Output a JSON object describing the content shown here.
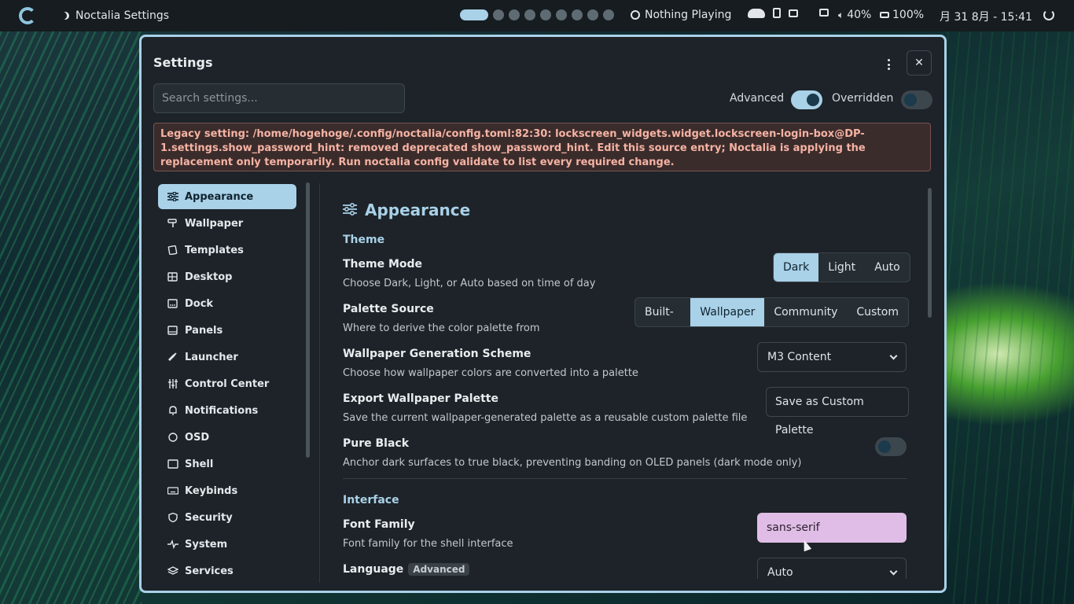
{
  "topbar": {
    "app_title": "Noctalia Settings",
    "workspaces": [
      true,
      false,
      false,
      false,
      false,
      false,
      false,
      false,
      false
    ],
    "media": "Nothing Playing",
    "volume": "40%",
    "battery": "100%",
    "datetime": "月 31 8月 - 15:41"
  },
  "window": {
    "title": "Settings",
    "search_placeholder": "Search settings...",
    "advanced_label": "Advanced",
    "advanced_on": true,
    "overridden_label": "Overridden",
    "overridden_on": false,
    "warning": "Legacy setting: /home/hogehoge/.config/noctalia/config.toml:82:30: lockscreen_widgets.widget.lockscreen-login-box@DP-1.settings.show_password_hint: removed deprecated show_password_hint. Edit this source entry; Noctalia is applying the replacement only temporarily. Run noctalia config validate to list every required change."
  },
  "sidebar": {
    "items": [
      {
        "label": "Appearance",
        "icon": "sliders-icon",
        "active": true
      },
      {
        "label": "Wallpaper",
        "icon": "paint-roller-icon"
      },
      {
        "label": "Templates",
        "icon": "templates-icon"
      },
      {
        "label": "Desktop",
        "icon": "desktop-icon"
      },
      {
        "label": "Dock",
        "icon": "dock-icon"
      },
      {
        "label": "Panels",
        "icon": "panels-icon"
      },
      {
        "label": "Launcher",
        "icon": "rocket-icon"
      },
      {
        "label": "Control Center",
        "icon": "control-center-icon"
      },
      {
        "label": "Notifications",
        "icon": "bell-icon"
      },
      {
        "label": "OSD",
        "icon": "speech-bubble-icon"
      },
      {
        "label": "Shell",
        "icon": "shell-icon"
      },
      {
        "label": "Keybinds",
        "icon": "keyboard-icon"
      },
      {
        "label": "Security",
        "icon": "shield-icon"
      },
      {
        "label": "System",
        "icon": "pulse-icon"
      },
      {
        "label": "Services",
        "icon": "layers-icon"
      }
    ]
  },
  "main": {
    "title": "Appearance",
    "theme_section": "Theme",
    "theme_mode": {
      "title": "Theme Mode",
      "desc": "Choose Dark, Light, or Auto based on time of day",
      "options": [
        "Dark",
        "Light",
        "Auto"
      ],
      "selected": "Dark"
    },
    "palette_source": {
      "title": "Palette Source",
      "desc": "Where to derive the color palette from",
      "options": [
        "Built-In",
        "Wallpaper",
        "Community",
        "Custom"
      ],
      "selected": "Wallpaper"
    },
    "gen_scheme": {
      "title": "Wallpaper Generation Scheme",
      "desc": "Choose how wallpaper colors are converted into a palette",
      "value": "M3 Content"
    },
    "export": {
      "title": "Export Wallpaper Palette",
      "desc": "Save the current wallpaper-generated palette as a reusable custom palette file",
      "button": "Save as Custom Palette"
    },
    "pure_black": {
      "title": "Pure Black",
      "desc": "Anchor dark surfaces to true black, preventing banding on OLED panels (dark mode only)",
      "on": false
    },
    "interface_section": "Interface",
    "font_family": {
      "title": "Font Family",
      "desc": "Font family for the shell interface",
      "value": "sans-serif"
    },
    "language": {
      "title": "Language",
      "badge": "Advanced",
      "value": "Auto"
    }
  },
  "colors": {
    "accent": "#a9d1e8",
    "surface": "#1d2328",
    "warning_text": "#f6b3a3",
    "font_field": "#e0bde6"
  }
}
